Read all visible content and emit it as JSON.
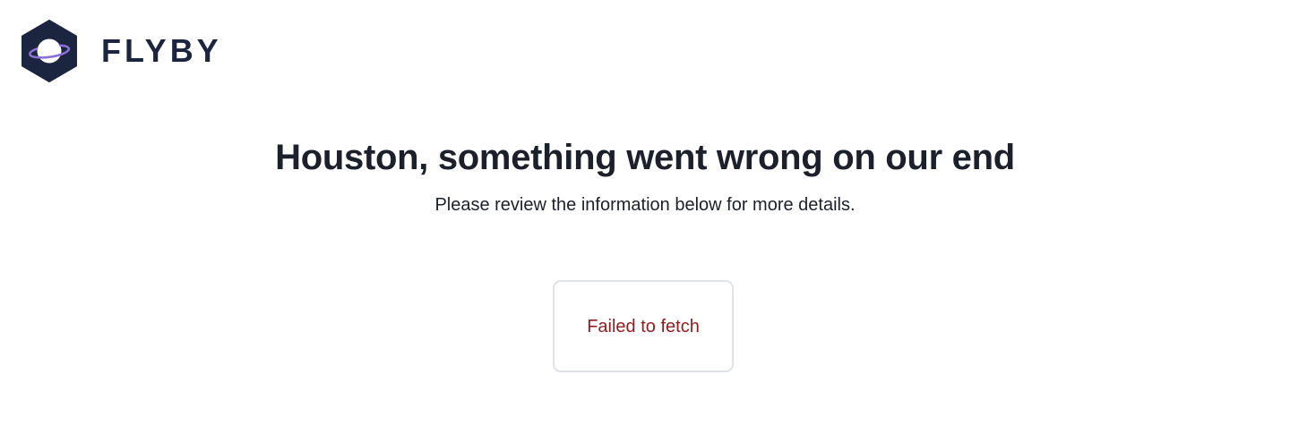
{
  "header": {
    "brand_name": "FLYBY",
    "logo_icon": "planet-hexagon-icon"
  },
  "error": {
    "title": "Houston, something went wrong on our end",
    "subtitle": "Please review the information below for more details.",
    "message": "Failed to fetch"
  },
  "colors": {
    "brand": "#1c2540",
    "ring_accent": "#8a6fd8",
    "error_text": "#921b1d",
    "box_border": "#dfe2e8"
  }
}
